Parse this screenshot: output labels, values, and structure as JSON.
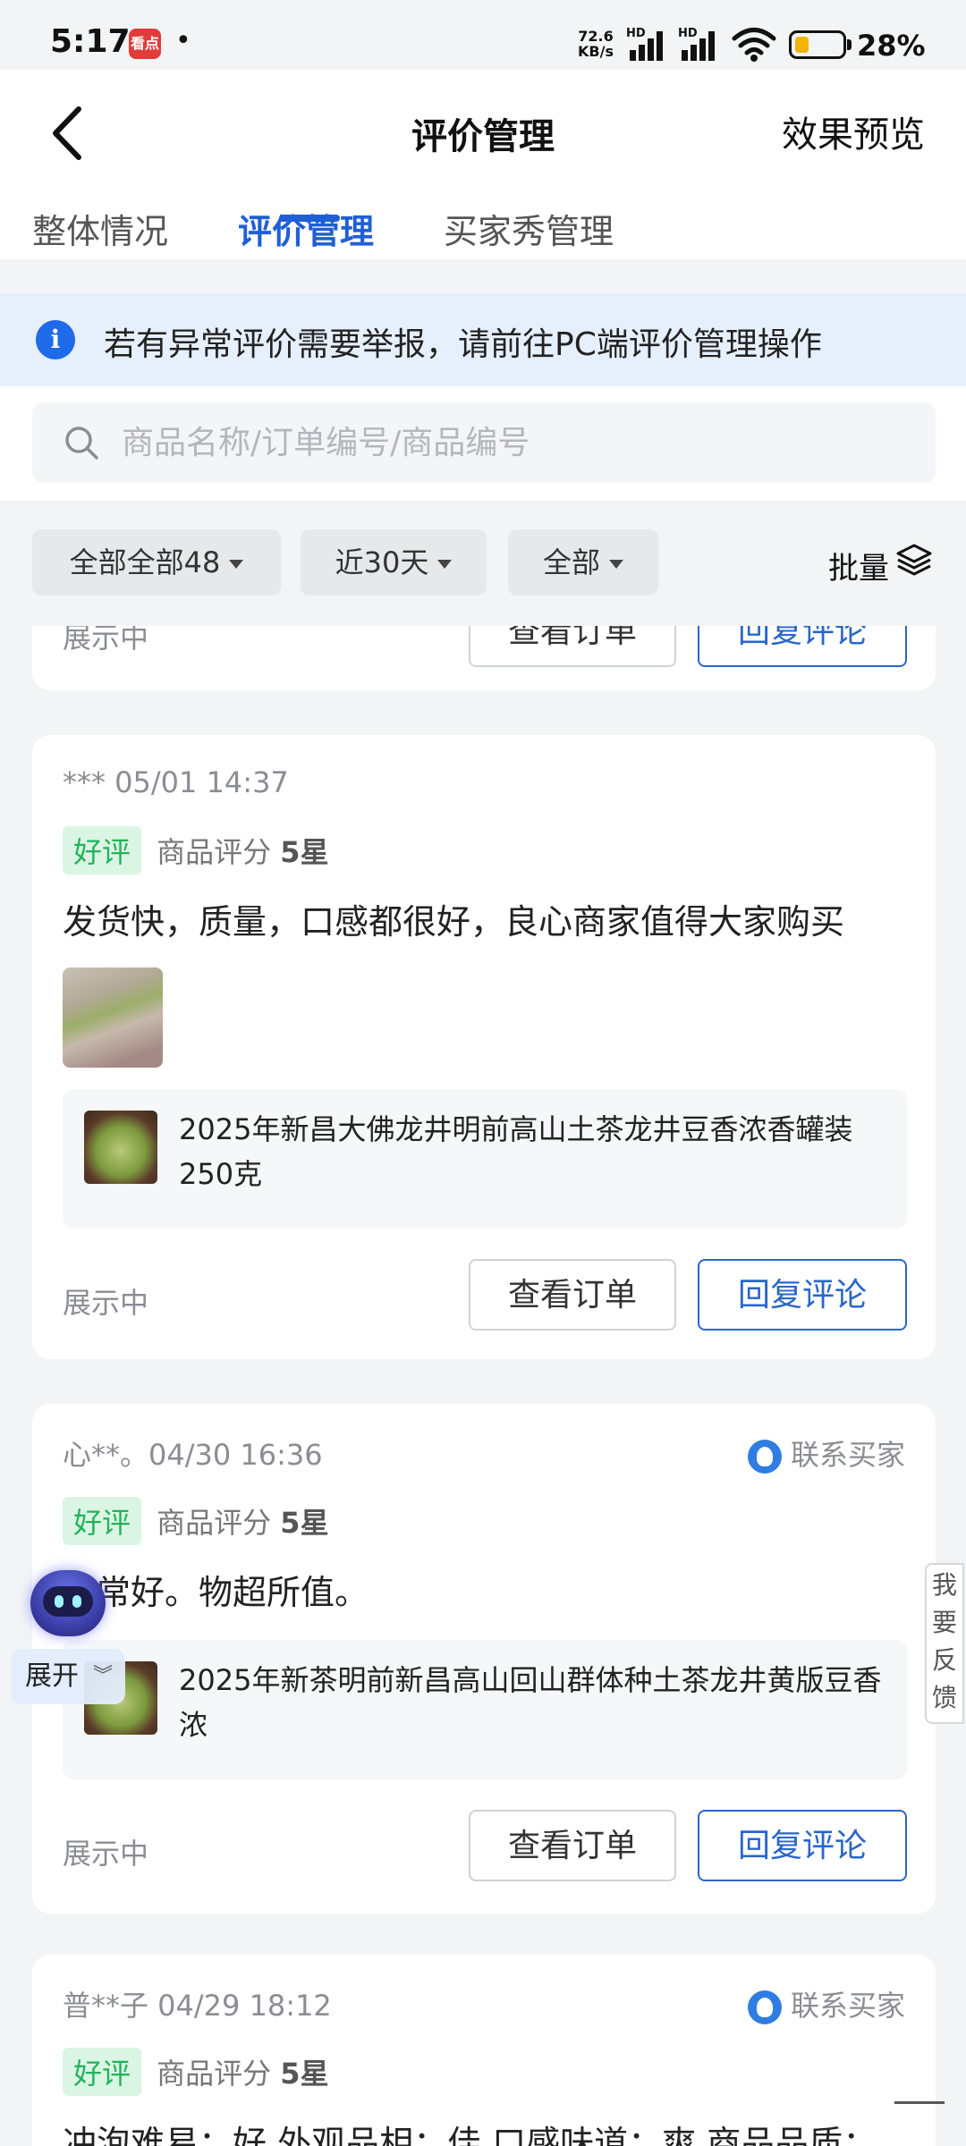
{
  "status_bar": {
    "time": "5:17",
    "app_icon_text": "看点",
    "dot": "•",
    "net_speed_value": "72.6",
    "net_speed_unit": "KB/s",
    "hd1": "HD",
    "hd2": "HD",
    "battery_level": 0.28,
    "battery_text": "28%"
  },
  "header": {
    "title": "评价管理",
    "preview_label": "效果预览",
    "back_icon": "chevron-left-icon"
  },
  "tabs": [
    {
      "label": "整体情况",
      "active": false
    },
    {
      "label": "评价管理",
      "active": true
    },
    {
      "label": "买家秀管理",
      "active": false
    }
  ],
  "notice": {
    "icon_glyph": "i",
    "text": "若有异常评价需要举报，请前往PC端评价管理操作"
  },
  "search": {
    "placeholder": "商品名称/订单编号/商品编号",
    "value": ""
  },
  "filters": {
    "chips": [
      {
        "label": "全部全部48"
      },
      {
        "label": "近30天"
      },
      {
        "label": "全部"
      }
    ],
    "batch_label": "批量"
  },
  "reviews": [
    {
      "status": "展示中",
      "view_order_label": "查看订单",
      "reply_label": "回复评论"
    },
    {
      "meta": "*** 05/01 14:37",
      "tag": "好评",
      "rating_label": "商品评分",
      "rating_value": "5星",
      "text": "发货快，质量，口感都很好，良心商家值得大家购买",
      "product_name": "2025年新昌大佛龙井明前高山土茶龙井豆香浓香罐装250克",
      "status": "展示中",
      "view_order_label": "查看订单",
      "reply_label": "回复评论"
    },
    {
      "meta": "心**。04/30 16:36",
      "contact_label": "联系买家",
      "tag": "好评",
      "rating_label": "商品评分",
      "rating_value": "5星",
      "text": "非常好。物超所值。",
      "product_name": "2025年新茶明前新昌高山回山群体种土茶龙井黄版豆香浓",
      "status": "展示中",
      "view_order_label": "查看订单",
      "reply_label": "回复评论"
    },
    {
      "meta": "普**子 04/29 18:12",
      "contact_label": "联系买家",
      "tag": "好评",
      "rating_label": "商品评分",
      "rating_value": "5星",
      "text": "冲泡难易：好 外观品相：佳 口感味道：爽 商品品质："
    }
  ],
  "floating": {
    "expand_label": "展开",
    "expand_chevron": "︾",
    "feedback_label": "我要反馈"
  }
}
